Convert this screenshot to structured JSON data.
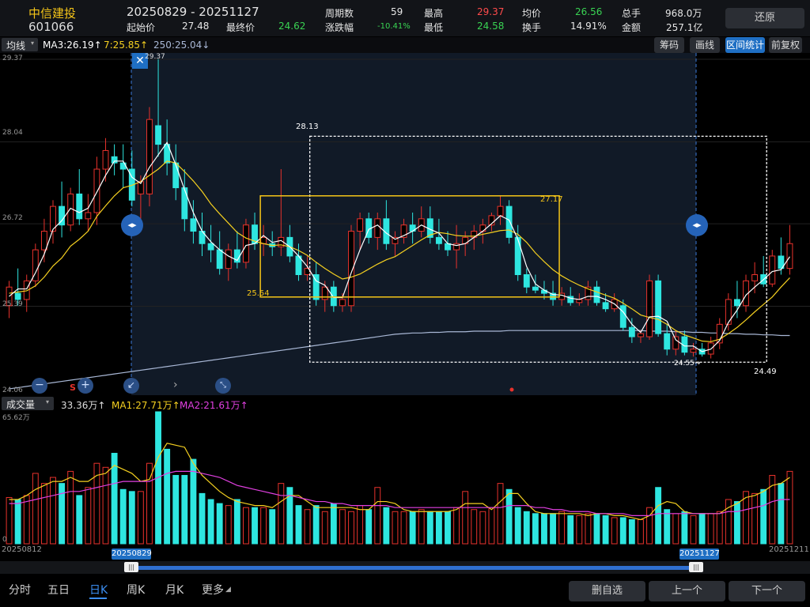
{
  "header": {
    "stock_name": "中信建投",
    "stock_code": "601066",
    "date_range": "20250829  - 20251127",
    "start_price_label": "起始价",
    "start_price": "27.48",
    "end_price_label": "最终价",
    "end_price": "24.62",
    "periods_label": "周期数",
    "periods": "59",
    "change_label": "涨跌幅",
    "change": "-10.41%",
    "high_label": "最高",
    "high": "29.37",
    "low_label": "最低",
    "low": "24.58",
    "avg_label": "均价",
    "avg": "26.56",
    "turnover_label": "换手",
    "turnover": "14.91%",
    "total_hands_label": "总手",
    "total_hands": "968.0万",
    "amount_label": "金额",
    "amount": "257.1亿",
    "restore_button": "还原"
  },
  "toolbar": {
    "ma_select": "均线",
    "ma3": "MA3:26.19↑",
    "ma7": "7:25.85↑",
    "ma250": "250:25.04↓",
    "chip_button": "筹码",
    "draw_button": "画线",
    "range_stats_button": "区间统计",
    "pre_restore_button": "前复权"
  },
  "price_axis": {
    "labels": [
      "29.37",
      "28.04",
      "26.72",
      "25.39",
      "24.06"
    ]
  },
  "annotations": {
    "high_marker": "29.37",
    "box_top_value": "28.13",
    "box_inner_high": "27.17",
    "box_inner_low": "25.54",
    "low_marker": "24.55→",
    "box_bottom_value": "24.49",
    "sell_marker": "S"
  },
  "volume": {
    "select": "成交量",
    "value": "33.36万↑",
    "ma1": "MA1:27.71万↑",
    "ma2": "MA2:21.61万↑",
    "axis_top": "65.62万",
    "axis_bottom": "0"
  },
  "dates": {
    "left": "20250812",
    "range_start": "20250829",
    "range_end": "20251127",
    "right": "20251211"
  },
  "tabs": [
    "分时",
    "五日",
    "日K",
    "周K",
    "月K",
    "更多"
  ],
  "actions": {
    "delete": "删自选",
    "prev": "上一个",
    "next": "下一个"
  },
  "colors": {
    "up": "#e8322c",
    "down": "#2ee6e0",
    "ma_white": "#ffffff",
    "ma_yellow": "#f5d020",
    "ma_long": "#a9b8d6",
    "vol_ma1": "#f5d020",
    "vol_ma2": "#e040e0",
    "accent": "#1f6fc4"
  },
  "chart_data": {
    "type": "candlestick",
    "price_ylim": [
      24.06,
      29.37
    ],
    "volume_ylim": [
      0,
      65.62
    ],
    "candles": [
      [
        25.4,
        25.8,
        25.2,
        25.7
      ],
      [
        25.6,
        26.0,
        25.4,
        25.5
      ],
      [
        25.5,
        25.9,
        25.3,
        25.8
      ],
      [
        25.8,
        26.4,
        25.7,
        26.3
      ],
      [
        26.3,
        26.8,
        26.1,
        26.6
      ],
      [
        26.6,
        27.1,
        26.4,
        27.0
      ],
      [
        27.0,
        27.4,
        26.5,
        26.7
      ],
      [
        26.7,
        27.3,
        26.6,
        27.2
      ],
      [
        27.2,
        27.6,
        26.7,
        26.8
      ],
      [
        26.8,
        27.2,
        26.6,
        26.9
      ],
      [
        26.9,
        27.8,
        26.7,
        27.6
      ],
      [
        27.6,
        28.1,
        27.4,
        27.9
      ],
      [
        27.8,
        28.0,
        27.5,
        27.7
      ],
      [
        27.7,
        28.0,
        27.3,
        27.6
      ],
      [
        27.6,
        27.9,
        27.0,
        27.1
      ],
      [
        27.2,
        27.5,
        26.8,
        27.4
      ],
      [
        27.2,
        28.6,
        27.0,
        28.4
      ],
      [
        28.3,
        29.37,
        27.8,
        28.0
      ],
      [
        28.0,
        28.4,
        27.5,
        27.7
      ],
      [
        27.7,
        28.0,
        27.1,
        27.3
      ],
      [
        27.3,
        27.6,
        26.6,
        26.8
      ],
      [
        26.8,
        27.1,
        26.4,
        26.6
      ],
      [
        26.6,
        26.9,
        26.2,
        26.4
      ],
      [
        26.4,
        26.7,
        26.1,
        26.3
      ],
      [
        26.3,
        26.6,
        25.9,
        26.0
      ],
      [
        26.0,
        26.4,
        25.8,
        26.3
      ],
      [
        26.3,
        26.6,
        26.0,
        26.1
      ],
      [
        26.1,
        26.8,
        26.0,
        26.7
      ],
      [
        26.7,
        26.9,
        26.3,
        26.4
      ],
      [
        26.4,
        26.7,
        26.2,
        26.5
      ],
      [
        26.4,
        26.6,
        26.2,
        26.35
      ],
      [
        26.35,
        27.6,
        26.2,
        26.5
      ],
      [
        26.5,
        26.7,
        26.1,
        26.2
      ],
      [
        26.2,
        26.4,
        25.8,
        25.9
      ],
      [
        25.9,
        26.2,
        25.8,
        26.0
      ],
      [
        25.9,
        26.1,
        25.4,
        25.5
      ],
      [
        25.5,
        25.8,
        25.3,
        25.7
      ],
      [
        25.7,
        25.8,
        25.3,
        25.4
      ],
      [
        25.4,
        25.6,
        25.3,
        25.5
      ],
      [
        25.4,
        26.7,
        25.3,
        26.6
      ],
      [
        26.6,
        26.9,
        26.3,
        26.8
      ],
      [
        26.8,
        26.9,
        26.4,
        26.5
      ],
      [
        26.5,
        26.9,
        26.3,
        26.8
      ],
      [
        26.8,
        27.1,
        26.3,
        26.4
      ],
      [
        26.4,
        26.6,
        26.2,
        26.5
      ],
      [
        26.5,
        26.8,
        26.4,
        26.7
      ],
      [
        26.7,
        26.9,
        26.4,
        26.6
      ],
      [
        26.6,
        27.0,
        26.5,
        26.8
      ],
      [
        26.8,
        27.0,
        26.4,
        26.5
      ],
      [
        26.5,
        26.8,
        26.3,
        26.4
      ],
      [
        26.4,
        26.6,
        26.2,
        26.3
      ],
      [
        26.3,
        26.7,
        26.0,
        26.4
      ],
      [
        26.4,
        26.6,
        26.2,
        26.5
      ],
      [
        26.5,
        26.7,
        26.3,
        26.6
      ],
      [
        26.6,
        26.8,
        26.4,
        26.7
      ],
      [
        26.7,
        26.9,
        26.6,
        26.85
      ],
      [
        26.85,
        27.17,
        26.7,
        27.0
      ],
      [
        27.0,
        27.1,
        26.4,
        26.5
      ],
      [
        26.5,
        26.7,
        25.8,
        25.9
      ],
      [
        25.9,
        26.0,
        25.6,
        25.7
      ],
      [
        25.7,
        25.9,
        25.6,
        25.65
      ],
      [
        25.65,
        25.8,
        25.5,
        25.6
      ],
      [
        25.6,
        25.8,
        25.4,
        25.5
      ],
      [
        25.5,
        25.7,
        25.4,
        25.6
      ],
      [
        25.55,
        25.7,
        25.4,
        25.45
      ],
      [
        25.45,
        25.6,
        25.4,
        25.5
      ],
      [
        25.5,
        25.8,
        25.4,
        25.7
      ],
      [
        25.7,
        25.8,
        25.4,
        25.45
      ],
      [
        25.45,
        25.6,
        25.3,
        25.35
      ],
      [
        25.35,
        25.6,
        25.3,
        25.5
      ],
      [
        25.4,
        25.5,
        25.0,
        25.05
      ],
      [
        25.05,
        25.2,
        24.8,
        24.9
      ],
      [
        24.9,
        25.0,
        24.8,
        24.95
      ],
      [
        24.9,
        25.9,
        24.85,
        25.8
      ],
      [
        25.8,
        25.9,
        24.9,
        24.95
      ],
      [
        24.95,
        25.1,
        24.6,
        24.7
      ],
      [
        24.7,
        25.0,
        24.6,
        24.9
      ],
      [
        24.9,
        25.0,
        24.6,
        24.65
      ],
      [
        24.65,
        24.8,
        24.58,
        24.7
      ],
      [
        24.7,
        24.8,
        24.58,
        24.62
      ],
      [
        24.62,
        24.9,
        24.55,
        24.8
      ],
      [
        24.8,
        25.2,
        24.7,
        25.1
      ],
      [
        25.1,
        25.6,
        25.0,
        25.5
      ],
      [
        25.5,
        25.8,
        25.2,
        25.4
      ],
      [
        25.4,
        25.9,
        25.3,
        25.8
      ],
      [
        25.8,
        26.1,
        25.6,
        25.9
      ],
      [
        25.9,
        26.2,
        25.7,
        25.75
      ],
      [
        25.75,
        26.3,
        25.7,
        26.2
      ],
      [
        26.2,
        26.5,
        25.9,
        26.0
      ],
      [
        26.0,
        26.7,
        25.9,
        26.4
      ]
    ],
    "volume": [
      23,
      22,
      24,
      35,
      30,
      33,
      30,
      36,
      24,
      28,
      40,
      38,
      45,
      27,
      26,
      26,
      40,
      65.62,
      47,
      34,
      34,
      42,
      25,
      22,
      20,
      19,
      22,
      18,
      18,
      18,
      17,
      30,
      28,
      19,
      17,
      19,
      16,
      20,
      17,
      16,
      19,
      17,
      28,
      18,
      16,
      16,
      16,
      17,
      16,
      16,
      16,
      18,
      26,
      17,
      16,
      18,
      30,
      27,
      18,
      16,
      15,
      15,
      15,
      16,
      14,
      14,
      15,
      15,
      14,
      13,
      13,
      12,
      12,
      18,
      28,
      17,
      15,
      16,
      14,
      15,
      15,
      16,
      22,
      21,
      26,
      25,
      27,
      34,
      30,
      36
    ],
    "ma_short": [
      25.55,
      25.67,
      25.67,
      25.93,
      26.23,
      26.63,
      26.77,
      26.97,
      26.9,
      26.97,
      27.23,
      27.5,
      27.73,
      27.73,
      27.47,
      27.37,
      27.63,
      27.83,
      28.03,
      27.67,
      27.27,
      26.9,
      26.6,
      26.43,
      26.3,
      26.2,
      26.13,
      26.37,
      26.4,
      26.53,
      26.42,
      26.45,
      26.35,
      26.2,
      26.03,
      25.8,
      25.73,
      25.53,
      25.53,
      25.93,
      26.3,
      26.63,
      26.7,
      26.57,
      26.47,
      26.53,
      26.6,
      26.7,
      26.63,
      26.57,
      26.4,
      26.37,
      26.4,
      26.5,
      26.6,
      26.72,
      26.85,
      26.78,
      26.47,
      26.03,
      25.75,
      25.65,
      25.58,
      25.57,
      25.52,
      25.5,
      25.55,
      25.55,
      25.5,
      25.43,
      25.3,
      25.1,
      24.97,
      25.22,
      25.23,
      25.15,
      24.85,
      24.75,
      24.75,
      24.66,
      24.7,
      24.84,
      25.13,
      25.33,
      25.57,
      25.7,
      25.82,
      25.95,
      25.98,
      26.19
    ],
    "ma_mid": [
      25.6,
      25.62,
      25.64,
      25.72,
      25.86,
      26.04,
      26.17,
      26.36,
      26.47,
      26.6,
      26.84,
      27.01,
      27.17,
      27.3,
      27.34,
      27.4,
      27.5,
      27.6,
      27.73,
      27.7,
      27.56,
      27.41,
      27.24,
      27.04,
      26.88,
      26.73,
      26.58,
      26.49,
      26.44,
      26.4,
      26.37,
      26.38,
      26.35,
      26.29,
      26.21,
      26.1,
      26.0,
      25.91,
      25.83,
      25.86,
      25.91,
      25.99,
      26.07,
      26.14,
      26.19,
      26.28,
      26.37,
      26.46,
      26.54,
      26.58,
      26.56,
      26.53,
      26.52,
      26.52,
      26.55,
      26.58,
      26.61,
      26.62,
      26.55,
      26.42,
      26.25,
      26.11,
      25.98,
      25.88,
      25.8,
      25.73,
      25.67,
      25.62,
      25.57,
      25.52,
      25.44,
      25.35,
      25.25,
      25.21,
      25.18,
      25.1,
      25.0,
      24.93,
      24.88,
      24.83,
      24.82,
      24.86,
      24.95,
      25.05,
      25.17,
      25.3,
      25.42,
      25.54,
      25.7,
      25.85
    ],
    "ma_long": [
      24.06,
      24.08,
      24.1,
      24.12,
      24.14,
      24.16,
      24.18,
      24.2,
      24.22,
      24.24,
      24.26,
      24.28,
      24.3,
      24.32,
      24.34,
      24.36,
      24.38,
      24.4,
      24.42,
      24.44,
      24.46,
      24.48,
      24.5,
      24.52,
      24.54,
      24.56,
      24.58,
      24.6,
      24.62,
      24.64,
      24.66,
      24.68,
      24.7,
      24.72,
      24.74,
      24.76,
      24.78,
      24.8,
      24.82,
      24.84,
      24.86,
      24.88,
      24.9,
      24.92,
      24.94,
      24.95,
      24.96,
      24.96,
      24.97,
      24.97,
      24.98,
      24.98,
      24.98,
      24.99,
      24.99,
      24.99,
      24.99,
      25.0,
      25.0,
      25.0,
      25.0,
      25.0,
      25.0,
      25.0,
      25.0,
      25.0,
      25.0,
      25.0,
      25.0,
      25.0,
      25.0,
      25.0,
      25.0,
      24.99,
      24.99,
      24.99,
      24.98,
      24.98,
      24.97,
      24.97,
      24.96,
      24.96,
      24.95,
      24.95,
      24.94,
      24.94,
      24.93,
      24.93,
      24.92,
      24.92
    ],
    "vol_ma1": [
      22,
      22,
      24,
      27,
      29,
      31,
      31,
      33,
      31,
      31,
      34,
      35,
      39,
      37,
      35,
      31,
      32,
      43,
      50,
      49,
      48,
      40,
      34,
      30,
      26,
      23,
      21,
      20,
      19,
      19,
      18,
      21,
      24,
      24,
      21,
      18,
      18,
      18,
      18,
      18,
      17,
      17,
      21,
      21,
      20,
      17,
      16,
      16,
      16,
      16,
      16,
      17,
      20,
      20,
      20,
      17,
      21,
      25,
      25,
      20,
      16,
      15,
      15,
      15,
      15,
      15,
      14,
      15,
      15,
      14,
      14,
      13,
      12,
      14,
      19,
      21,
      20,
      16,
      15,
      15,
      15,
      15,
      18,
      20,
      23,
      24,
      26,
      29,
      30,
      33
    ],
    "vol_ma2": [
      20,
      20,
      21,
      22,
      23,
      24,
      25,
      26,
      26,
      27,
      28,
      29,
      30,
      31,
      31,
      31,
      31,
      33,
      35,
      36,
      36,
      36,
      35,
      34,
      33,
      31,
      29,
      28,
      27,
      26,
      25,
      24,
      24,
      23,
      22,
      21,
      21,
      20,
      20,
      19,
      19,
      19,
      19,
      19,
      18,
      18,
      18,
      18,
      18,
      18,
      18,
      18,
      18,
      18,
      18,
      18,
      18,
      19,
      19,
      19,
      18,
      18,
      17,
      17,
      16,
      16,
      16,
      15,
      15,
      15,
      15,
      14,
      14,
      14,
      15,
      15,
      15,
      15,
      15,
      15,
      15,
      15,
      16,
      16,
      17,
      18,
      19,
      21,
      22,
      22
    ]
  }
}
